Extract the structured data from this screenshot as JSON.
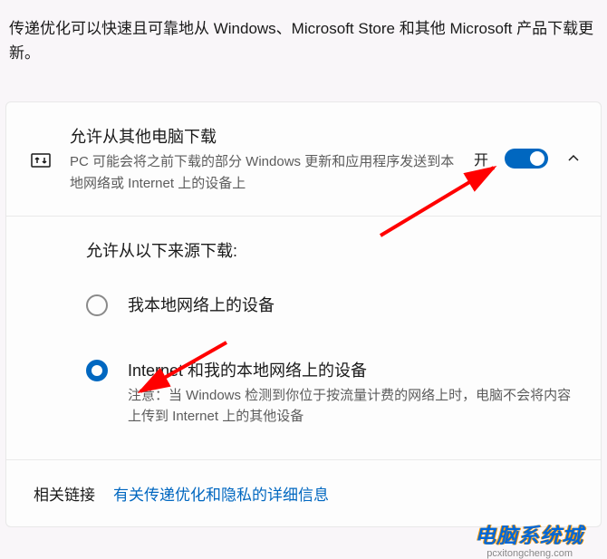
{
  "header": {
    "description": "传递优化可以快速且可靠地从 Windows、Microsoft Store 和其他 Microsoft 产品下载更新。"
  },
  "card": {
    "allowFromOtherPCs": {
      "title": "允许从其他电脑下载",
      "subtitle": "PC 可能会将之前下载的部分 Windows 更新和应用程序发送到本地网络或 Internet 上的设备上",
      "toggleState": "开",
      "toggleOn": true
    },
    "sources": {
      "heading": "允许从以下来源下载:",
      "options": [
        {
          "label": "我本地网络上的设备",
          "note": "",
          "selected": false
        },
        {
          "label": "Internet 和我的本地网络上的设备",
          "note": "注意：当 Windows 检测到你位于按流量计费的网络上时，电脑不会将内容上传到 Internet 上的其他设备",
          "selected": true
        }
      ]
    }
  },
  "footer": {
    "label": "相关链接",
    "link": "有关传递优化和隐私的详细信息"
  },
  "watermark": {
    "brand": "电脑系统城",
    "url": "pcxitongcheng.com"
  }
}
